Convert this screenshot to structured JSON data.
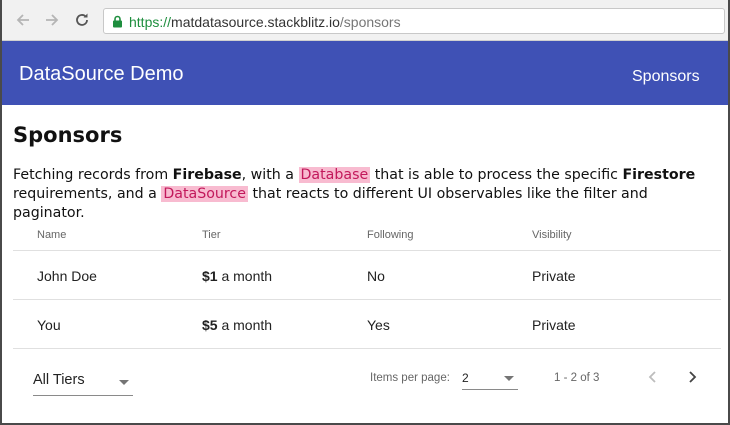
{
  "browser": {
    "url_protocol": "https://",
    "url_host": "matdatasource.stackblitz.io",
    "url_path": "/sponsors"
  },
  "toolbar": {
    "app_title": "DataSource Demo",
    "nav_link": "Sponsors",
    "color": "#3f51b5"
  },
  "page": {
    "title": "Sponsors",
    "intro": {
      "t1": "Fetching records from ",
      "b1": "Firebase",
      "t2": ", with a ",
      "h1": "Database",
      "t3": " that is able to process the specific ",
      "b2": "Firestore",
      "t4": " requirements, and a ",
      "h2": "DataSource",
      "t5": " that reacts to different UI observables like the filter and paginator."
    }
  },
  "table": {
    "columns": [
      "Name",
      "Tier",
      "Following",
      "Visibility"
    ],
    "rows": [
      {
        "name": "John Doe",
        "tier_amount": "$1",
        "tier_period": " a month",
        "following": "No",
        "visibility": "Private"
      },
      {
        "name": "You",
        "tier_amount": "$5",
        "tier_period": " a month",
        "following": "Yes",
        "visibility": "Private"
      }
    ]
  },
  "filter": {
    "selected": "All Tiers"
  },
  "paginator": {
    "items_per_page_label": "Items per page:",
    "items_per_page": "2",
    "range_label": "1 - 2 of 3"
  },
  "icons": {
    "back": "arrow-left-icon",
    "forward": "arrow-right-icon",
    "reload": "reload-icon",
    "secure": "lock-icon",
    "prev": "chevron-left-icon",
    "next": "chevron-right-icon"
  }
}
